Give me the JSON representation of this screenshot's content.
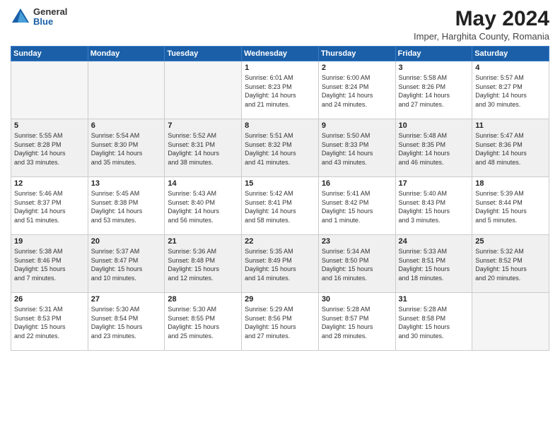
{
  "header": {
    "logo_general": "General",
    "logo_blue": "Blue",
    "month_year": "May 2024",
    "location": "Imper, Harghita County, Romania"
  },
  "weekdays": [
    "Sunday",
    "Monday",
    "Tuesday",
    "Wednesday",
    "Thursday",
    "Friday",
    "Saturday"
  ],
  "weeks": [
    [
      {
        "day": "",
        "info": ""
      },
      {
        "day": "",
        "info": ""
      },
      {
        "day": "",
        "info": ""
      },
      {
        "day": "1",
        "info": "Sunrise: 6:01 AM\nSunset: 8:23 PM\nDaylight: 14 hours\nand 21 minutes."
      },
      {
        "day": "2",
        "info": "Sunrise: 6:00 AM\nSunset: 8:24 PM\nDaylight: 14 hours\nand 24 minutes."
      },
      {
        "day": "3",
        "info": "Sunrise: 5:58 AM\nSunset: 8:26 PM\nDaylight: 14 hours\nand 27 minutes."
      },
      {
        "day": "4",
        "info": "Sunrise: 5:57 AM\nSunset: 8:27 PM\nDaylight: 14 hours\nand 30 minutes."
      }
    ],
    [
      {
        "day": "5",
        "info": "Sunrise: 5:55 AM\nSunset: 8:28 PM\nDaylight: 14 hours\nand 33 minutes."
      },
      {
        "day": "6",
        "info": "Sunrise: 5:54 AM\nSunset: 8:30 PM\nDaylight: 14 hours\nand 35 minutes."
      },
      {
        "day": "7",
        "info": "Sunrise: 5:52 AM\nSunset: 8:31 PM\nDaylight: 14 hours\nand 38 minutes."
      },
      {
        "day": "8",
        "info": "Sunrise: 5:51 AM\nSunset: 8:32 PM\nDaylight: 14 hours\nand 41 minutes."
      },
      {
        "day": "9",
        "info": "Sunrise: 5:50 AM\nSunset: 8:33 PM\nDaylight: 14 hours\nand 43 minutes."
      },
      {
        "day": "10",
        "info": "Sunrise: 5:48 AM\nSunset: 8:35 PM\nDaylight: 14 hours\nand 46 minutes."
      },
      {
        "day": "11",
        "info": "Sunrise: 5:47 AM\nSunset: 8:36 PM\nDaylight: 14 hours\nand 48 minutes."
      }
    ],
    [
      {
        "day": "12",
        "info": "Sunrise: 5:46 AM\nSunset: 8:37 PM\nDaylight: 14 hours\nand 51 minutes."
      },
      {
        "day": "13",
        "info": "Sunrise: 5:45 AM\nSunset: 8:38 PM\nDaylight: 14 hours\nand 53 minutes."
      },
      {
        "day": "14",
        "info": "Sunrise: 5:43 AM\nSunset: 8:40 PM\nDaylight: 14 hours\nand 56 minutes."
      },
      {
        "day": "15",
        "info": "Sunrise: 5:42 AM\nSunset: 8:41 PM\nDaylight: 14 hours\nand 58 minutes."
      },
      {
        "day": "16",
        "info": "Sunrise: 5:41 AM\nSunset: 8:42 PM\nDaylight: 15 hours\nand 1 minute."
      },
      {
        "day": "17",
        "info": "Sunrise: 5:40 AM\nSunset: 8:43 PM\nDaylight: 15 hours\nand 3 minutes."
      },
      {
        "day": "18",
        "info": "Sunrise: 5:39 AM\nSunset: 8:44 PM\nDaylight: 15 hours\nand 5 minutes."
      }
    ],
    [
      {
        "day": "19",
        "info": "Sunrise: 5:38 AM\nSunset: 8:46 PM\nDaylight: 15 hours\nand 7 minutes."
      },
      {
        "day": "20",
        "info": "Sunrise: 5:37 AM\nSunset: 8:47 PM\nDaylight: 15 hours\nand 10 minutes."
      },
      {
        "day": "21",
        "info": "Sunrise: 5:36 AM\nSunset: 8:48 PM\nDaylight: 15 hours\nand 12 minutes."
      },
      {
        "day": "22",
        "info": "Sunrise: 5:35 AM\nSunset: 8:49 PM\nDaylight: 15 hours\nand 14 minutes."
      },
      {
        "day": "23",
        "info": "Sunrise: 5:34 AM\nSunset: 8:50 PM\nDaylight: 15 hours\nand 16 minutes."
      },
      {
        "day": "24",
        "info": "Sunrise: 5:33 AM\nSunset: 8:51 PM\nDaylight: 15 hours\nand 18 minutes."
      },
      {
        "day": "25",
        "info": "Sunrise: 5:32 AM\nSunset: 8:52 PM\nDaylight: 15 hours\nand 20 minutes."
      }
    ],
    [
      {
        "day": "26",
        "info": "Sunrise: 5:31 AM\nSunset: 8:53 PM\nDaylight: 15 hours\nand 22 minutes."
      },
      {
        "day": "27",
        "info": "Sunrise: 5:30 AM\nSunset: 8:54 PM\nDaylight: 15 hours\nand 23 minutes."
      },
      {
        "day": "28",
        "info": "Sunrise: 5:30 AM\nSunset: 8:55 PM\nDaylight: 15 hours\nand 25 minutes."
      },
      {
        "day": "29",
        "info": "Sunrise: 5:29 AM\nSunset: 8:56 PM\nDaylight: 15 hours\nand 27 minutes."
      },
      {
        "day": "30",
        "info": "Sunrise: 5:28 AM\nSunset: 8:57 PM\nDaylight: 15 hours\nand 28 minutes."
      },
      {
        "day": "31",
        "info": "Sunrise: 5:28 AM\nSunset: 8:58 PM\nDaylight: 15 hours\nand 30 minutes."
      },
      {
        "day": "",
        "info": ""
      }
    ]
  ]
}
